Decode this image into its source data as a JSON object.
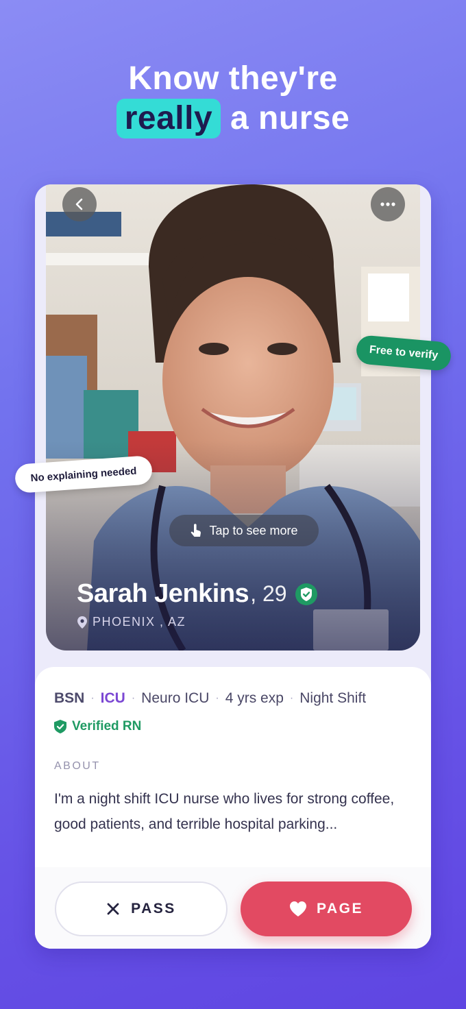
{
  "headline": {
    "line1": "Know they're",
    "highlight": "really",
    "rest": "a nurse"
  },
  "colors": {
    "background_top": "#8b8cf4",
    "background_bottom": "#5f45e2",
    "highlight": "#34dcd6",
    "verified_green": "#1f9a63",
    "icu_purple": "#7b47d3",
    "page_button": "#e24a62"
  },
  "profile": {
    "name": "Sarah Jenkins",
    "age": ", 29",
    "location": "PHOENIX , AZ",
    "tap_hint": "Tap to see more",
    "tags": {
      "degree": "BSN",
      "unit": "ICU",
      "specialty": "Neuro ICU",
      "experience": "4 yrs exp",
      "shift": "Night Shift"
    },
    "verified_label": "Verified RN",
    "about_label": "ABOUT",
    "about_text": "I'm a night shift ICU nurse who lives for strong coffee, good patients, and terrible hospital parking..."
  },
  "icons": {
    "back": "chevron-left-icon",
    "more": "more-dots-icon",
    "tap": "tap-hand-icon",
    "verified": "shield-check-icon",
    "location": "location-pin-icon",
    "pass": "close-icon",
    "page": "heart-icon"
  },
  "actions": {
    "pass_label": "PASS",
    "page_label": "PAGE"
  },
  "stickers": {
    "free_verify": "Free to verify",
    "no_explaining": "No explaining needed"
  }
}
